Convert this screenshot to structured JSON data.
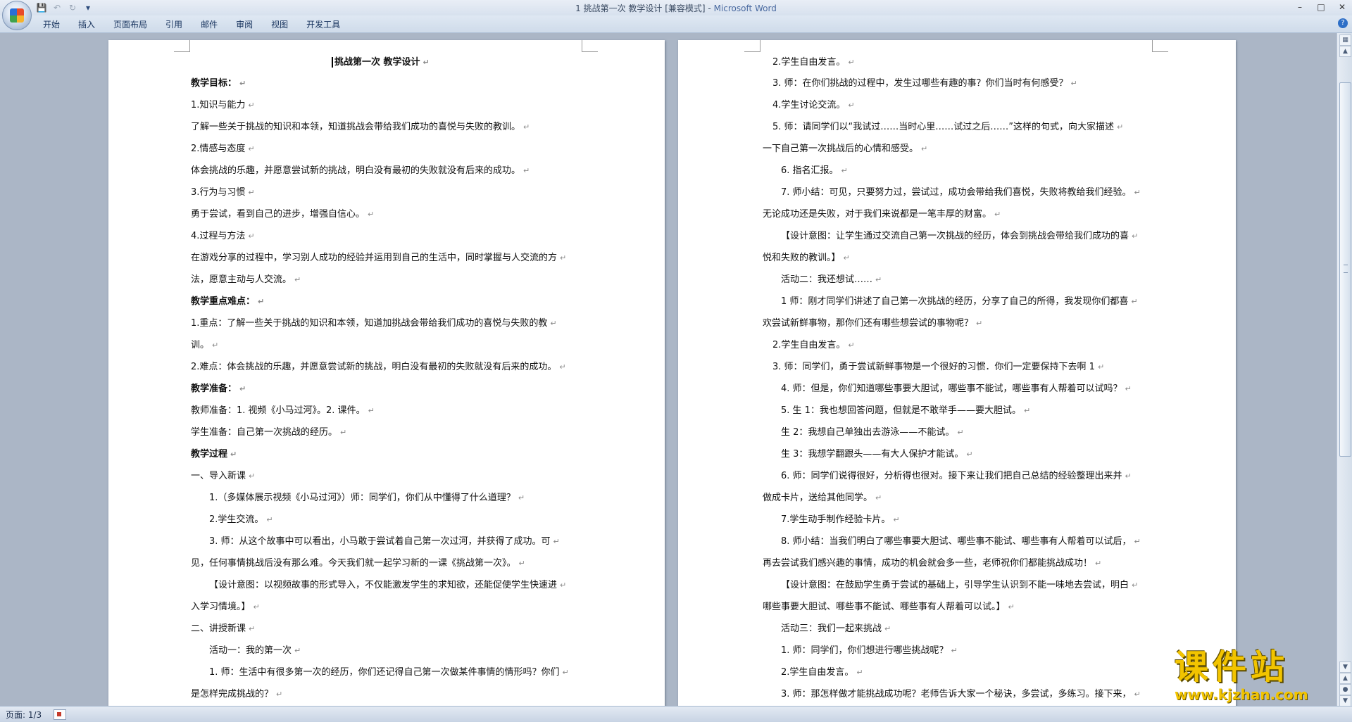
{
  "window": {
    "doc_title": "1 挑战第一次 教学设计 [兼容模式] - ",
    "app_name": "Microsoft Word"
  },
  "quick_access": {
    "save_icon": "save-icon",
    "undo_icon": "undo-icon",
    "redo_icon": "redo-icon",
    "customize_icon": "customize-icon"
  },
  "ribbon": {
    "tabs": [
      "开始",
      "插入",
      "页面布局",
      "引用",
      "邮件",
      "审阅",
      "视图",
      "开发工具"
    ]
  },
  "status_bar": {
    "page": "页面: 1/3"
  },
  "watermark": {
    "title": "课件站",
    "url": "www.kjzhan.com"
  },
  "left_page": {
    "lines": [
      "挑战第一次  教学设计",
      "教学目标：",
      "1.知识与能力",
      "了解一些关于挑战的知识和本领，知道挑战会带给我们成功的喜悦与失败的教训。",
      "2.情感与态度",
      "体会挑战的乐趣，并愿意尝试新的挑战，明白没有最初的失败就没有后来的成功。",
      "3.行为与习惯",
      "勇于尝试，看到自己的进步，增强自信心。",
      "4.过程与方法",
      "在游戏分享的过程中，学习别人成功的经验并运用到自己的生活中，同时掌握与人交流的方",
      "法，愿意主动与人交流。",
      "教学重点难点：",
      "1.重点：了解一些关于挑战的知识和本领，知道加挑战会带给我们成功的喜悦与失败的教",
      "训。",
      "2.难点：体会挑战的乐趣，并愿意尝试新的挑战，明白没有最初的失败就没有后来的成功。",
      "教学准备：",
      "教师准备：1. 视频《小马过河》。2. 课件。",
      "学生准备：自己第一次挑战的经历。",
      "教学过程",
      "一、导入新课",
      "1.（多媒体展示视频《小马过河》）师：同学们，你们从中懂得了什么道理？",
      "2.学生交流。",
      "3. 师：从这个故事中可以看出，小马敢于尝试着自己第一次过河，并获得了成功。可",
      "见，任何事情挑战后没有那么难。今天我们就一起学习新的一课《挑战第一次》。",
      "【设计意图：以视频故事的形式导入，不仅能激发学生的求知欲，还能促使学生快速进",
      "入学习情境。】",
      "二、讲授新课",
      "活动一：我的第一次",
      "1. 师：生活中有很多第一次的经历，你们还记得自己第一次做某件事情的情形吗？你们",
      "是怎样完成挑战的？"
    ]
  },
  "right_page": {
    "lines": [
      "2.学生自由发言。",
      "3. 师：在你们挑战的过程中，发生过哪些有趣的事？你们当时有何感受？",
      "4.学生讨论交流。",
      "5. 师：请同学们以“我试过……当时心里……试过之后……”这样的句式，向大家描述",
      "一下自己第一次挑战后的心情和感受。",
      "6. 指名汇报。",
      "7. 师小结：可见，只要努力过，尝试过，成功会带给我们喜悦，失败将教给我们经验。",
      "无论成功还是失败，对于我们来说都是一笔丰厚的财富。",
      "【设计意图：让学生通过交流自己第一次挑战的经历，体会到挑战会带给我们成功的喜",
      "悦和失败的教训。】",
      "活动二：我还想试……",
      "1 师：刚才同学们讲述了自己第一次挑战的经历，分享了自己的所得，我发现你们都喜",
      "欢尝试新鲜事物，那你们还有哪些想尝试的事物呢？",
      "2.学生自由发言。",
      "3. 师：同学们，勇于尝试新鲜事物是一个很好的习惯．你们一定要保持下去啊 1",
      "4. 师：但是，你们知道哪些事要大胆试，哪些事不能试，哪些事有人帮着可以试吗？",
      "5. 生 1：我也想回答问题，但就是不敢举手——要大胆试。",
      "生 2：我想自己单独出去游泳——不能试。",
      "生 3：我想学翻跟头——有大人保护才能试。",
      "6. 师：同学们说得很好，分析得也很对。接下来让我们把自己总结的经验整理出来并",
      "做成卡片，送给其他同学。",
      "7.学生动手制作经验卡片。",
      "8. 师小结：当我们明白了哪些事要大胆试、哪些事不能试、哪些事有人帮着可以试后，",
      "再去尝试我们感兴趣的事情，成功的机会就会多一些，老师祝你们都能挑战成功！",
      "【设计意图：在鼓励学生勇于尝试的基础上，引导学生认识到不能一味地去尝试，明白",
      "哪些事要大胆试、哪些事不能试、哪些事有人帮着可以试。】",
      "活动三：我们一起来挑战",
      "1. 师：同学们，你们想进行哪些挑战呢？",
      "2.学生自由发言。",
      "3. 师：那怎样做才能挑战成功呢？老师告诉大家一个秘诀，多尝试，多练习。接下来，"
    ]
  }
}
